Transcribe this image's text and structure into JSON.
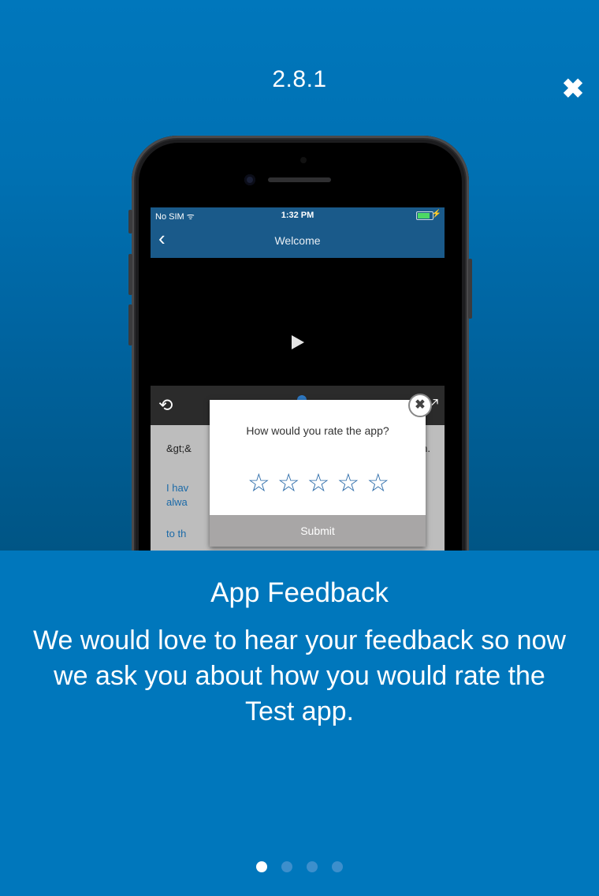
{
  "header": {
    "version": "2.8.1",
    "close_glyph": "✖"
  },
  "phone_screen": {
    "status": {
      "carrier": "No SIM",
      "wifi_glyph": "ᯤ",
      "time": "1:32 PM",
      "bolt": "⚡"
    },
    "nav": {
      "back_glyph": "‹",
      "title": "Welcome"
    },
    "controls": {
      "replay_glyph": "⟲",
      "expand_glyph": "⤢"
    },
    "content": {
      "line1_left": "&gt;&",
      "line1_right": "man.",
      "line2": "I hav",
      "line3": "alwa",
      "line4": "to th"
    },
    "popup": {
      "question": "How would you rate the app?",
      "stars": [
        "☆",
        "☆",
        "☆",
        "☆",
        "☆"
      ],
      "submit": "Submit",
      "close_glyph": "✖"
    }
  },
  "feature": {
    "title": "App Feedback",
    "description": "We would love to hear your feedback so now we ask you about how you would rate the Test app."
  },
  "pager": {
    "total": 4,
    "active_index": 0
  },
  "colors": {
    "background": "#0077bc",
    "accent": "#2a6aa8",
    "submit": "#a8a6a6"
  }
}
